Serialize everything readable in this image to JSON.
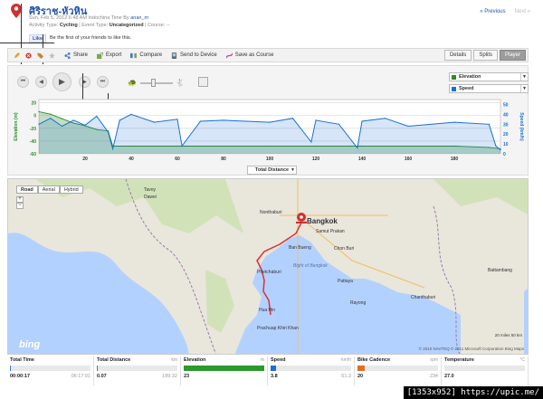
{
  "header": {
    "title": "ศิริราช-หัวหิน",
    "meta_prefix": "Sun, Feb 5, 2012 6:48 AM Indochina Time By",
    "author": "anan_m",
    "activity_type_label": "Activity Type:",
    "activity_type": "Cycling",
    "event_type_label": "| Event Type:",
    "event_type": "Uncategorized",
    "course_label": "| Course: --",
    "like_button": "Like",
    "like_text": "Be the first of your friends to like this.",
    "prev": "« Previous",
    "next": "Next »"
  },
  "toolbar": {
    "share": "Share",
    "export": "Export",
    "compare": "Compare",
    "send": "Send to Device",
    "save_course": "Save as Course",
    "tabs": [
      "Details",
      "Splits",
      "Player"
    ],
    "active_tab": "Player"
  },
  "player": {
    "legend_1": "Elevation",
    "legend_2": "Speed",
    "x_select": "Total Distance",
    "colors": {
      "elevation": "#2a8a2a",
      "speed": "#1a6fd6"
    }
  },
  "chart_data": {
    "type": "line",
    "xlabel": "Total Distance",
    "ylabel_left": "Elevation (m)",
    "ylabel_right": "Speed (km/h)",
    "xlim": [
      0,
      200
    ],
    "x_ticks": [
      "20",
      "40",
      "60",
      "80",
      "100",
      "120",
      "140",
      "160",
      "180"
    ],
    "y_left_ticks": [
      "20",
      "0",
      "-20",
      "-40",
      "-60"
    ],
    "y_right_ticks": [
      "50",
      "40",
      "30",
      "20",
      "10",
      "0"
    ],
    "series": [
      {
        "name": "Elevation",
        "color": "#2a8a2a",
        "x": [
          0,
          5,
          10,
          15,
          20,
          25,
          30,
          32,
          40,
          60,
          80,
          100,
          120,
          135,
          140,
          160,
          180,
          195,
          200
        ],
        "values": [
          6,
          2,
          -5,
          -12,
          -16,
          -22,
          -24,
          -48,
          -48,
          -48,
          -48,
          -48,
          -48,
          -48,
          -48,
          -48,
          -48,
          -50,
          -52
        ]
      },
      {
        "name": "Speed",
        "color": "#1a6fd6",
        "x": [
          0,
          5,
          10,
          15,
          20,
          25,
          30,
          32,
          35,
          40,
          50,
          60,
          62,
          70,
          80,
          100,
          110,
          118,
          120,
          130,
          138,
          140,
          150,
          160,
          180,
          195,
          198,
          200
        ],
        "values": [
          30,
          36,
          28,
          34,
          29,
          38,
          22,
          5,
          34,
          40,
          32,
          35,
          8,
          33,
          34,
          32,
          36,
          12,
          34,
          30,
          6,
          33,
          36,
          28,
          32,
          30,
          8,
          4
        ]
      }
    ]
  },
  "map": {
    "types": [
      "Road",
      "Aerial",
      "Hybrid"
    ],
    "active_type": "Road",
    "zoom_in": "+",
    "zoom_out": "−",
    "logo": "bing",
    "copyright": "© 2010 NAVTEQ   © 2011 Microsoft Corporation   Bing Maps",
    "scale_text": "20 miles  50 km",
    "labels": [
      "Tavoy",
      "Dawei",
      "Nonthaburi",
      "Bangkok",
      "Samut Prakan",
      "Chon Buri",
      "Ban Bueng",
      "Phetchaburi",
      "Hua Hin",
      "Bight of Bangkok",
      "Rayong",
      "Chanthaburi",
      "Battambang",
      "Pattaya",
      "Prachuap Khiri Khan"
    ],
    "colors": {
      "land": "#e9e6dc",
      "water": "#b3d1ff",
      "green": "#c8dfa8",
      "route": "#e03030"
    }
  },
  "stats": [
    {
      "label": "Total Time",
      "unit": "",
      "min": "00:00:17",
      "max": "06:17:01",
      "fill_pct": 1,
      "color": "#3a7bd5"
    },
    {
      "label": "Total Distance",
      "unit": "km",
      "min": "0.07",
      "max": "189.32",
      "fill_pct": 1,
      "color": "#3a7bd5"
    },
    {
      "label": "Elevation",
      "unit": "m",
      "min": "23",
      "max": "",
      "fill_pct": 100,
      "color": "#2a9a2a"
    },
    {
      "label": "Speed",
      "unit": "km/h",
      "min": "3.8",
      "max": "51.3",
      "fill_pct": 7,
      "color": "#1a6fd6"
    },
    {
      "label": "Bike Cadence",
      "unit": "rpm",
      "min": "20",
      "max": "234",
      "fill_pct": 9,
      "color": "#e07020"
    },
    {
      "label": "Temperature",
      "unit": "°C",
      "min": "27.0",
      "max": "",
      "fill_pct": 0,
      "color": "#999999"
    }
  ],
  "watermark": "[1353x952] https://upic.me/"
}
